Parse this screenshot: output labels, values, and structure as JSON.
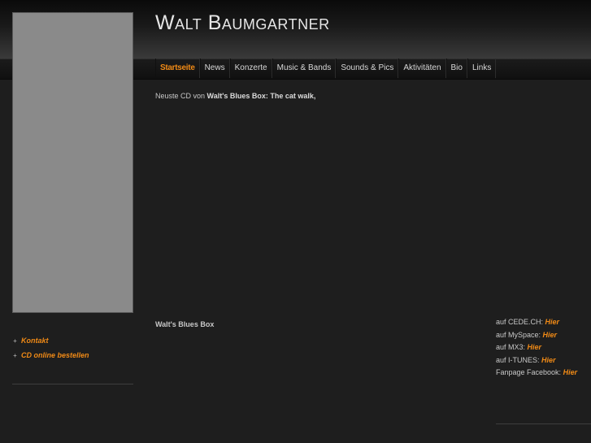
{
  "site": {
    "title": "Walt Baumgartner"
  },
  "nav": {
    "items": [
      {
        "label": "Startseite"
      },
      {
        "label": "News"
      },
      {
        "label": "Konzerte"
      },
      {
        "label": "Music & Bands"
      },
      {
        "label": "Sounds & Pics"
      },
      {
        "label": "Aktivitäten"
      },
      {
        "label": "Bio"
      },
      {
        "label": "Links"
      }
    ],
    "active": "Startseite"
  },
  "sidebar": {
    "links": [
      {
        "label": "Kontakt"
      },
      {
        "label": "CD online bestellen"
      }
    ]
  },
  "main": {
    "intro_prefix": "Neuste CD von",
    "intro_bold": "Walt's Blues Box: The cat walk,",
    "section_title": "Walt's Blues Box"
  },
  "buy_links": [
    {
      "text": "auf CEDE.CH:",
      "link": "Hier"
    },
    {
      "text": "auf MySpace:",
      "link": "Hier"
    },
    {
      "text": "auf MX3:",
      "link": "Hier"
    },
    {
      "text": "auf I-TUNES:",
      "link": "Hier"
    },
    {
      "text": "Fanpage Facebook:",
      "link": "Hier"
    }
  ],
  "colors": {
    "accent": "#f08a16",
    "background": "#1e1e1e",
    "sidebar_image": "#8a8a8a"
  }
}
